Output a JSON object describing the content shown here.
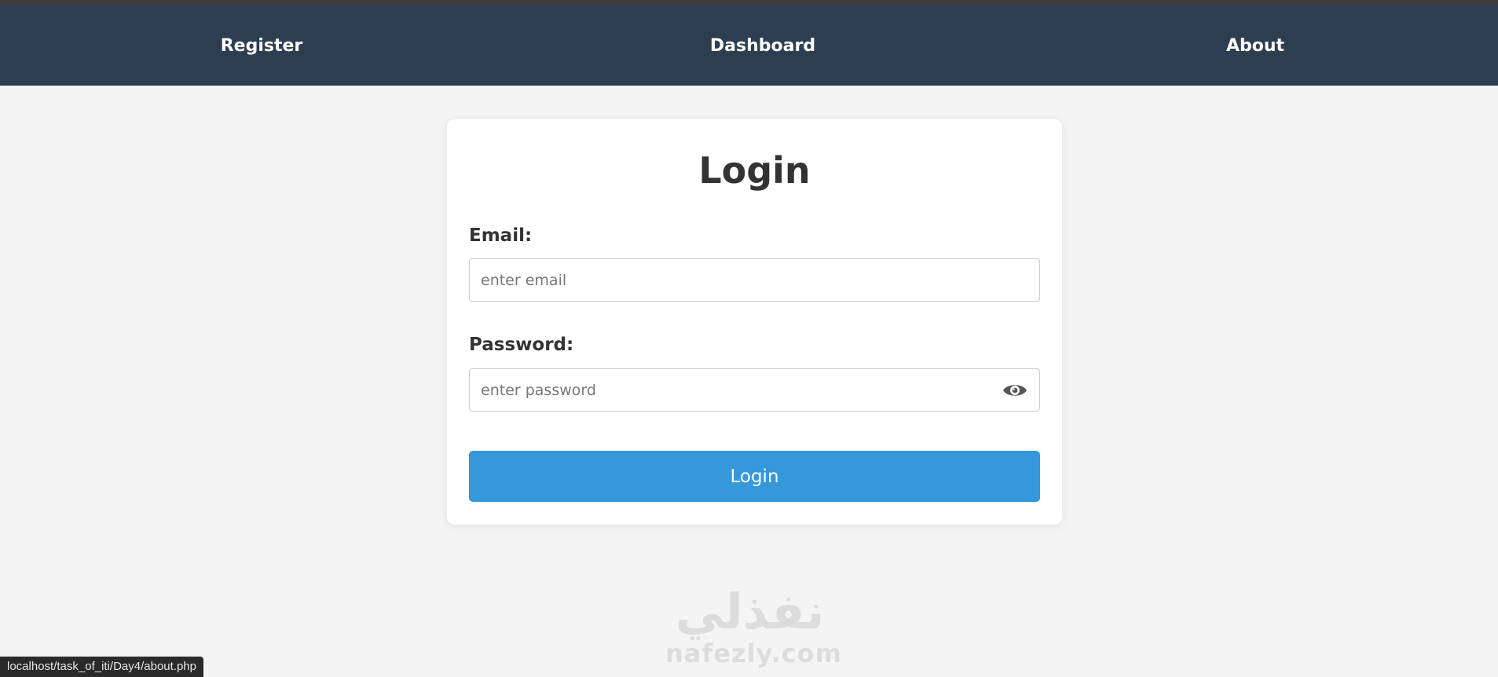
{
  "nav": {
    "links": [
      {
        "label": "Register"
      },
      {
        "label": "Dashboard"
      },
      {
        "label": "About"
      }
    ]
  },
  "login_form": {
    "title": "Login",
    "email": {
      "label": "Email:",
      "placeholder": "enter email",
      "value": ""
    },
    "password": {
      "label": "Password:",
      "placeholder": "enter password",
      "value": "",
      "toggle_icon": "eye-icon"
    },
    "submit_label": "Login"
  },
  "watermark": {
    "logo_text": "نفذلي",
    "url_text": "nafezly.com"
  },
  "status_bar": {
    "url": "localhost/task_of_iti/Day4/about.php"
  },
  "colors": {
    "navbar": "#2c3e50",
    "page_background": "#f4f4f4",
    "button": "#3498db",
    "heading_text": "#333333"
  }
}
